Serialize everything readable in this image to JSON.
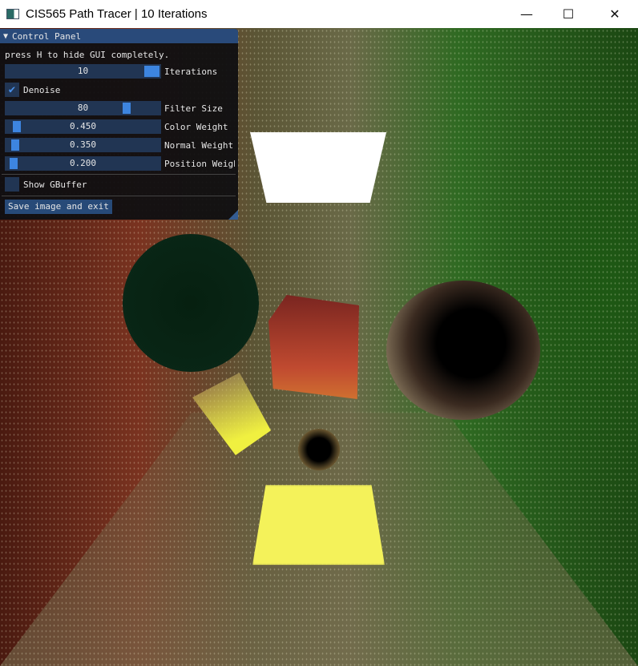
{
  "window": {
    "title": "CIS565 Path Tracer | 10 Iterations",
    "minimize": "—",
    "maximize": "☐",
    "close": "✕"
  },
  "panel": {
    "header": "Control Panel",
    "collapse_icon": "▼",
    "hint": "press H to hide GUI completely.",
    "iterations": {
      "value": "10",
      "label": "Iterations"
    },
    "denoise": {
      "label": "Denoise",
      "checked": true,
      "check": "✔"
    },
    "filter_size": {
      "value": "80",
      "label": "Filter Size"
    },
    "color_weight": {
      "value": "0.450",
      "label": "Color Weight"
    },
    "normal_weight": {
      "value": "0.350",
      "label": "Normal Weight"
    },
    "position_weight": {
      "value": "0.200",
      "label": "Position Weight"
    },
    "show_gbuffer": {
      "label": "Show GBuffer",
      "checked": false
    },
    "save_button": "Save image and exit"
  },
  "colors": {
    "panel_header": "#294a7a",
    "slider_bg": "#213553",
    "grab": "#3d85e0"
  }
}
